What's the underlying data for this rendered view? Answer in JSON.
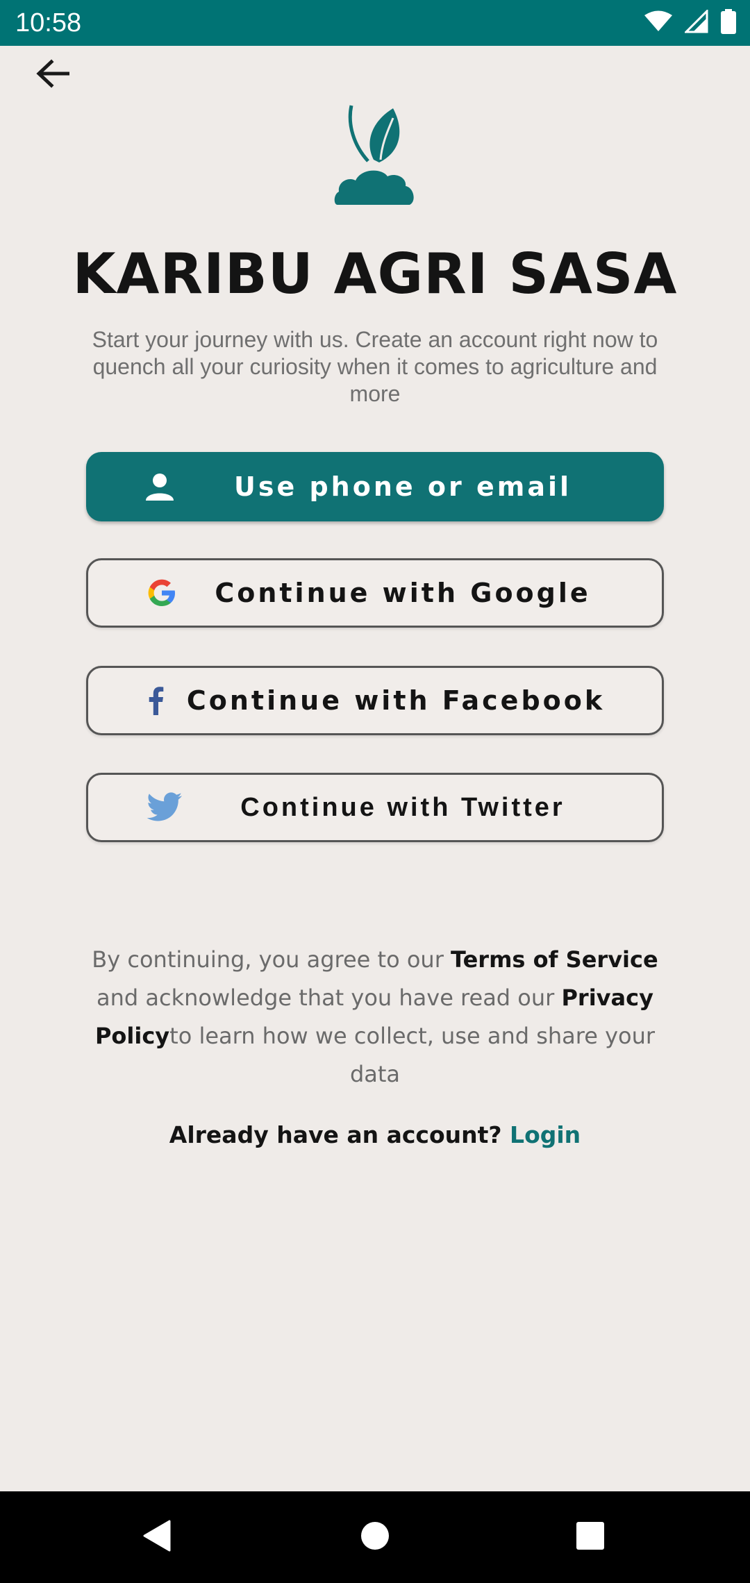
{
  "status_bar": {
    "time": "10:58",
    "icons": [
      "wifi-icon",
      "signal-icon",
      "battery-icon"
    ]
  },
  "header": {
    "back_icon": "arrow-left-icon"
  },
  "brand": {
    "title": "KARIBU AGRI SASA",
    "subtitle": "Start your journey with us. Create an account right now to quench all your curiosity when it comes to agriculture and more",
    "logo_icon": "plant-sprout-icon",
    "accent_color": "#107274"
  },
  "auth_buttons": {
    "phone_email": {
      "label": "Use phone or email",
      "icon": "person-icon"
    },
    "google": {
      "label": "Continue with Google",
      "icon": "google-icon"
    },
    "facebook": {
      "label": "Continue with Facebook",
      "icon": "facebook-icon"
    },
    "twitter": {
      "label": "Continue with Twitter",
      "icon": "twitter-icon"
    }
  },
  "legal": {
    "prefix": "By continuing, you agree to our ",
    "terms": "Terms of Service",
    "middle": " and acknowledge that you have read our ",
    "privacy": "Privacy Policy",
    "suffix": "to learn how we collect, use and share your data"
  },
  "login_prompt": {
    "text": "Already have an account? ",
    "link": "Login"
  },
  "nav_bar": {
    "buttons": [
      "back-triangle-icon",
      "home-circle-icon",
      "recents-square-icon"
    ]
  }
}
